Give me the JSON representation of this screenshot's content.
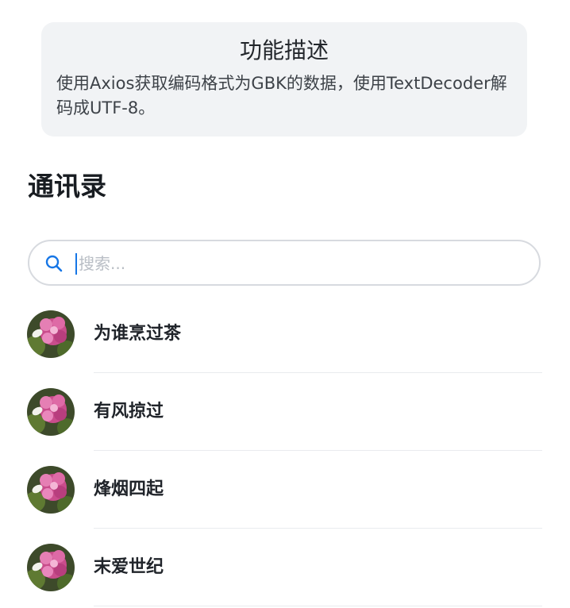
{
  "description_card": {
    "title": "功能描述",
    "body": "使用Axios获取编码格式为GBK的数据，使用TextDecoder解码成UTF-8。"
  },
  "section": {
    "title": "通讯录"
  },
  "search": {
    "placeholder": "搜索..."
  },
  "contacts": [
    {
      "name": "为谁烹过茶"
    },
    {
      "name": "有风掠过"
    },
    {
      "name": "烽烟四起"
    },
    {
      "name": "末爱世纪"
    }
  ],
  "icons": {
    "search": "search-icon",
    "avatar": "flower-avatar"
  },
  "colors": {
    "accent": "#1676e6",
    "card_bg": "#f1f3f5",
    "placeholder": "#b9bec5"
  }
}
